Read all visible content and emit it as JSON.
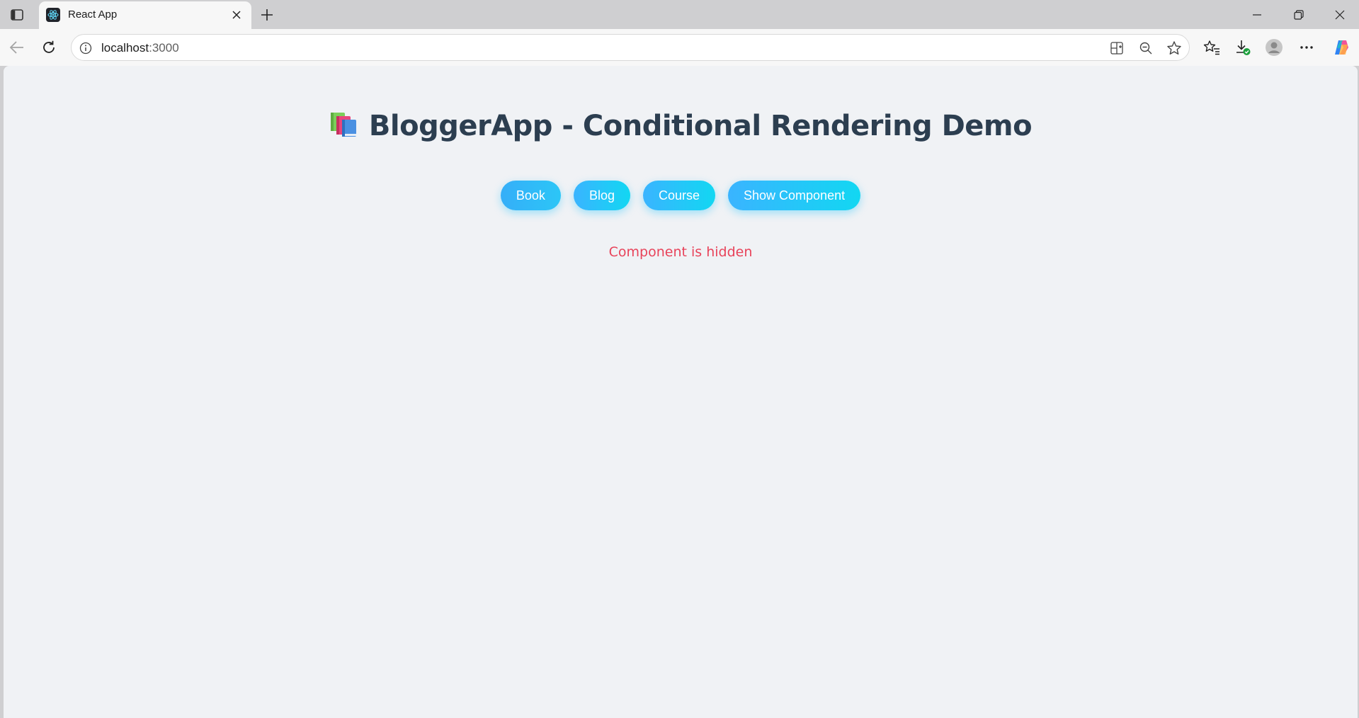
{
  "browser": {
    "tab": {
      "title": "React App",
      "favicon": "react-logo-icon"
    },
    "address_bar": {
      "host": "localhost",
      "port": ":3000"
    },
    "colors": {
      "chrome": "#cfcfd1",
      "toolbar": "#f7f7f7"
    }
  },
  "page": {
    "title": "BloggerApp - Conditional Rendering Demo",
    "title_icon": "books-emoji",
    "buttons": [
      {
        "label": "Book"
      },
      {
        "label": "Blog"
      },
      {
        "label": "Course"
      },
      {
        "label": "Show Component"
      }
    ],
    "status_message": "Component is hidden",
    "colors": {
      "background": "#f0f2f5",
      "title": "#2c3e50",
      "status": "#e8435a",
      "button_gradient_start": "#3ab4ff",
      "button_gradient_end": "#12d7f2"
    }
  }
}
